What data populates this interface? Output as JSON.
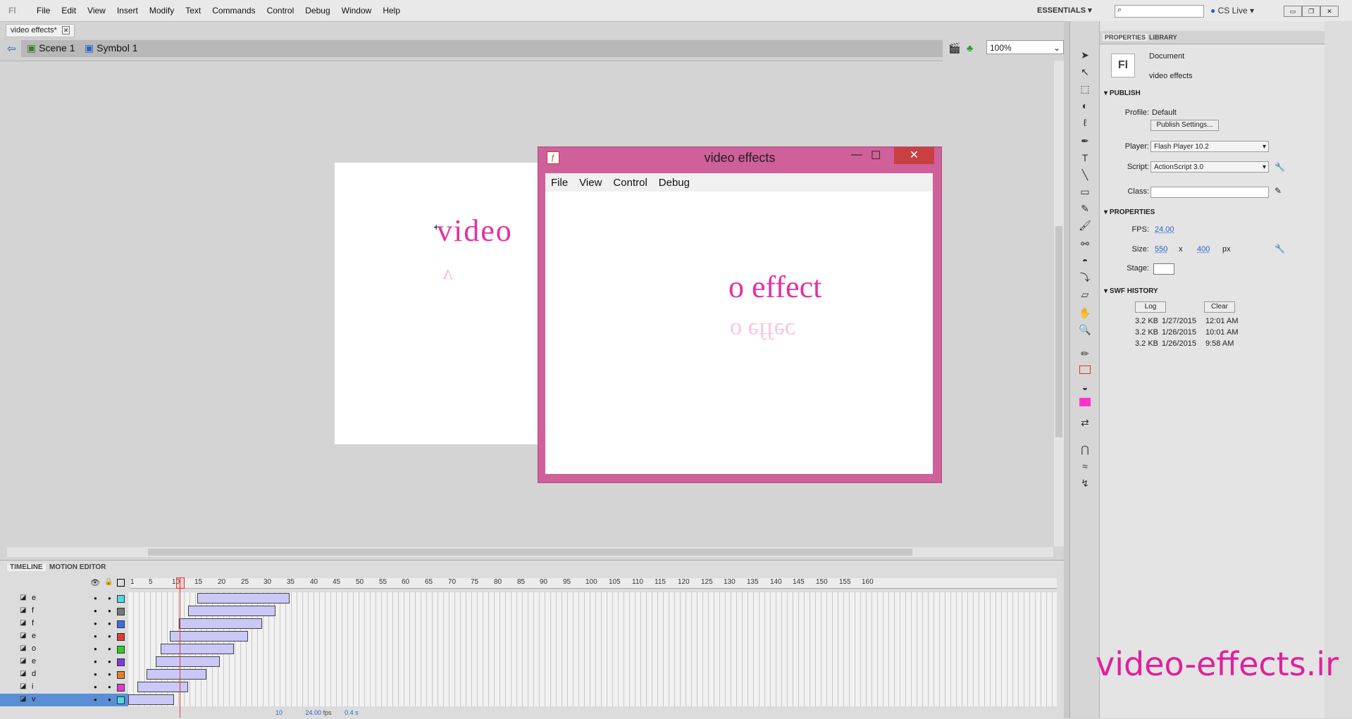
{
  "app": {
    "logo": "Fl"
  },
  "menu": [
    "File",
    "Edit",
    "View",
    "Insert",
    "Modify",
    "Text",
    "Commands",
    "Control",
    "Debug",
    "Window",
    "Help"
  ],
  "workspace": {
    "label": "ESSENTIALS",
    "cs_live": "CS Live"
  },
  "document": {
    "tab_title": "video effects*"
  },
  "breadcrumb": {
    "scene": "Scene 1",
    "symbol": "Symbol 1"
  },
  "zoom": "100%",
  "stage": {
    "text": "video"
  },
  "player": {
    "title": "video effects",
    "menu": [
      "File",
      "View",
      "Control",
      "Debug"
    ],
    "text": "o effect"
  },
  "timeline": {
    "tabs": [
      "TIMELINE",
      "MOTION EDITOR"
    ],
    "frame_numbers": [
      1,
      5,
      10,
      15,
      20,
      25,
      30,
      35,
      40,
      45,
      50,
      55,
      60,
      65,
      70,
      75,
      80,
      85,
      90,
      95,
      100,
      105,
      110,
      115,
      120,
      125,
      130,
      135,
      140,
      145,
      150,
      155,
      160
    ],
    "current_frame": "10",
    "fps": "24.00",
    "fps_unit": "fps",
    "time": "0.4 s",
    "layers": [
      {
        "name": "e",
        "color": "#4fd8e8",
        "tween_start": 16,
        "tween_end": 35
      },
      {
        "name": "f",
        "color": "#777777",
        "tween_start": 14,
        "tween_end": 32
      },
      {
        "name": "f",
        "color": "#3b6fe0",
        "tween_start": 12,
        "tween_end": 29
      },
      {
        "name": "e",
        "color": "#e03b3b",
        "tween_start": 10,
        "tween_end": 26
      },
      {
        "name": "o",
        "color": "#37c92c",
        "tween_start": 8,
        "tween_end": 23
      },
      {
        "name": "e",
        "color": "#7b3be0",
        "tween_start": 7,
        "tween_end": 20
      },
      {
        "name": "d",
        "color": "#e0802b",
        "tween_start": 5,
        "tween_end": 17
      },
      {
        "name": "i",
        "color": "#e03bd8",
        "tween_start": 3,
        "tween_end": 13
      },
      {
        "name": "v",
        "color": "#4fd8e8",
        "tween_start": 1,
        "tween_end": 10
      }
    ]
  },
  "properties": {
    "tabs": [
      "PROPERTIES",
      "LIBRARY"
    ],
    "doc_type": "Document",
    "doc_name": "video effects",
    "publish_header": "PUBLISH",
    "profile_label": "Profile:",
    "profile_value": "Default",
    "publish_settings_button": "Publish Settings...",
    "player_label": "Player:",
    "player_value": "Flash Player 10.2",
    "script_label": "Script:",
    "script_value": "ActionScript 3.0",
    "class_label": "Class:",
    "properties_header": "PROPERTIES",
    "fps_label": "FPS:",
    "fps_value": "24.00",
    "size_label": "Size:",
    "width": "550",
    "x": "x",
    "height": "400",
    "px": "px",
    "stage_label": "Stage:",
    "swf_header": "SWF HISTORY",
    "log_button": "Log",
    "clear_button": "Clear",
    "history": [
      {
        "size": "3.2 KB",
        "date": "1/27/2015",
        "time": "12:01 AM"
      },
      {
        "size": "3.2 KB",
        "date": "1/26/2015",
        "time": "10:01 AM"
      },
      {
        "size": "3.2 KB",
        "date": "1/26/2015",
        "time": "9:58 AM"
      }
    ]
  },
  "watermark": "video-effects.ir"
}
